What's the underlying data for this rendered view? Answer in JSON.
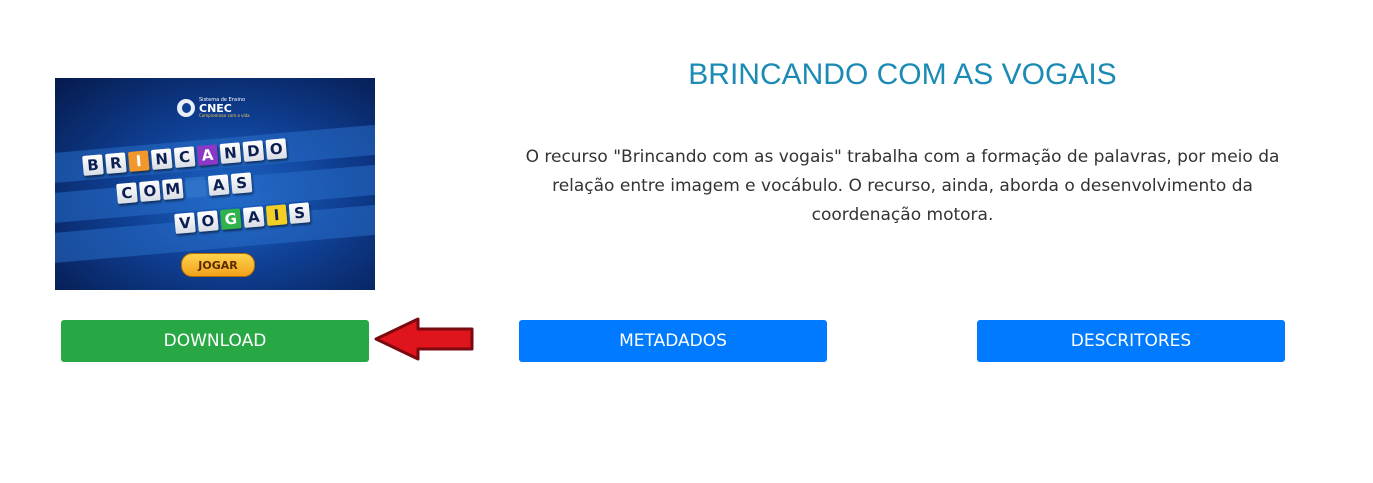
{
  "thumbnail": {
    "logo_small": "Sistema de Ensino",
    "logo_brand": "CNEC",
    "logo_tagline": "Compromisso com a vida",
    "row1": [
      "B",
      "R",
      "I",
      "N",
      "C",
      "A",
      "N",
      "D",
      "O"
    ],
    "row2": [
      "C",
      "O",
      "M",
      "",
      "A",
      "S"
    ],
    "row3": [
      "V",
      "O",
      "G",
      "A",
      "I",
      "S"
    ],
    "play_label": "JOGAR"
  },
  "resource": {
    "title": "BRINCANDO COM AS VOGAIS",
    "description": "O recurso \"Brincando com as vogais\" trabalha com a formação de palavras, por meio da relação entre imagem e vocábulo. O recurso, ainda, aborda o desenvolvimento da coordenação motora."
  },
  "actions": {
    "download_label": "DOWNLOAD",
    "metadata_label": "METADADOS",
    "descriptors_label": "DESCRITORES"
  },
  "colors": {
    "title": "#1b8bb5",
    "download": "#28a745",
    "primary": "#007bff",
    "arrow": "#e0141c"
  },
  "icons": {
    "pointer": "arrow-left-icon"
  }
}
